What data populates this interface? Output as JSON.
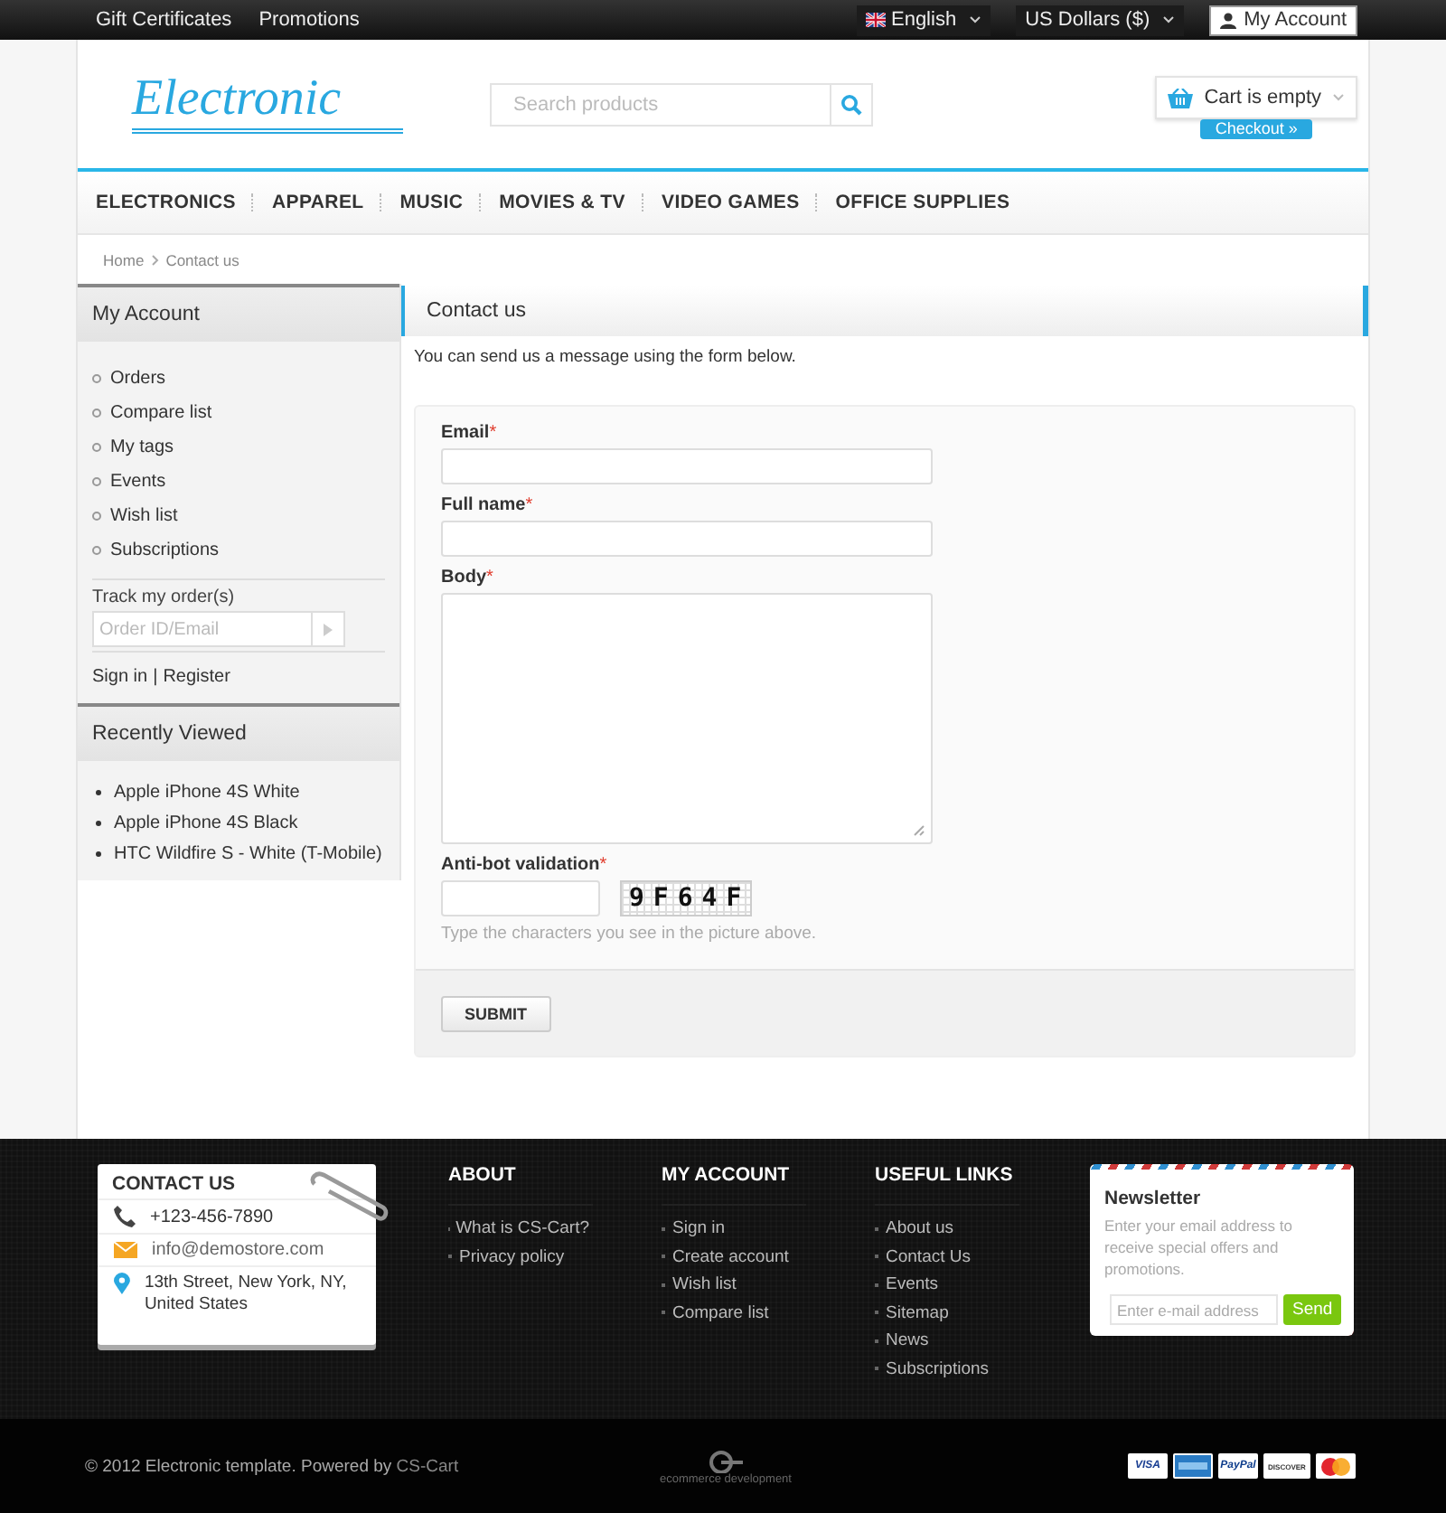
{
  "top_bar": {
    "links": [
      "Gift Certificates",
      "Promotions"
    ],
    "language": "English",
    "currency": "US Dollars ($)",
    "account": "My Account"
  },
  "header": {
    "logo": "Electronic",
    "search": {
      "placeholder": "Search products"
    },
    "cart": {
      "label": "Cart is empty",
      "checkout": "Checkout »"
    }
  },
  "nav": [
    "ELECTRONICS",
    "APPAREL",
    "MUSIC",
    "MOVIES & TV",
    "VIDEO GAMES",
    "OFFICE SUPPLIES"
  ],
  "breadcrumb": [
    "Home",
    "Contact us"
  ],
  "sidebar": {
    "my_account": {
      "title": "My Account",
      "items": [
        "Orders",
        "Compare list",
        "My tags",
        "Events",
        "Wish list",
        "Subscriptions"
      ],
      "track_label": "Track my order(s)",
      "track_placeholder": "Order ID/Email",
      "sign_in": "Sign in",
      "separator": "|",
      "register": "Register"
    },
    "recently_viewed": {
      "title": "Recently Viewed",
      "items": [
        "Apple iPhone 4S White",
        "Apple iPhone 4S Black",
        "HTC Wildfire S - White (T-Mobile)"
      ]
    }
  },
  "content": {
    "title": "Contact us",
    "intro": "You can send us a message using the form below.",
    "fields": [
      {
        "kind": "input",
        "label": "Email",
        "mark": "*"
      },
      {
        "kind": "input",
        "label": "Full name",
        "mark": "*"
      },
      {
        "kind": "textarea",
        "label": "Body",
        "mark": "*"
      },
      {
        "kind": "captcha",
        "label": "Anti-bot validation",
        "mark": "*",
        "captcha": "9F64F",
        "hint": "Type the characters you see in the picture above."
      }
    ],
    "submit": "SUBMIT"
  },
  "footer": {
    "contact": {
      "title": "CONTACT US",
      "phone": "+123-456-7890",
      "email": "info@demostore.com",
      "address": "13th Street, New York, NY, United States"
    },
    "columns": [
      {
        "title": "ABOUT",
        "links": [
          "What is CS-Cart?",
          "Privacy policy"
        ]
      },
      {
        "title": "MY ACCOUNT",
        "links": [
          "Sign in",
          "Create account",
          "Wish list",
          "Compare list"
        ]
      },
      {
        "title": "USEFUL LINKS",
        "links": [
          "About us",
          "Contact Us",
          "Events",
          "Sitemap",
          "News",
          "Subscriptions"
        ]
      }
    ],
    "newsletter": {
      "title": "Newsletter",
      "text": "Enter your email address to receive special offers and promotions.",
      "placeholder": "Enter e-mail address",
      "button": "Send"
    },
    "copyright": "© 2012 Electronic template.  Powered by",
    "powered_link": "CS-Cart",
    "center_logo": "ecommerce development",
    "payments": [
      {
        "kind": "visa",
        "label": "VISA"
      },
      {
        "kind": "amex"
      },
      {
        "kind": "paypal",
        "label": "PayPal"
      },
      {
        "kind": "discover",
        "label": "DISCOVER"
      },
      {
        "kind": "mastercard"
      }
    ]
  }
}
